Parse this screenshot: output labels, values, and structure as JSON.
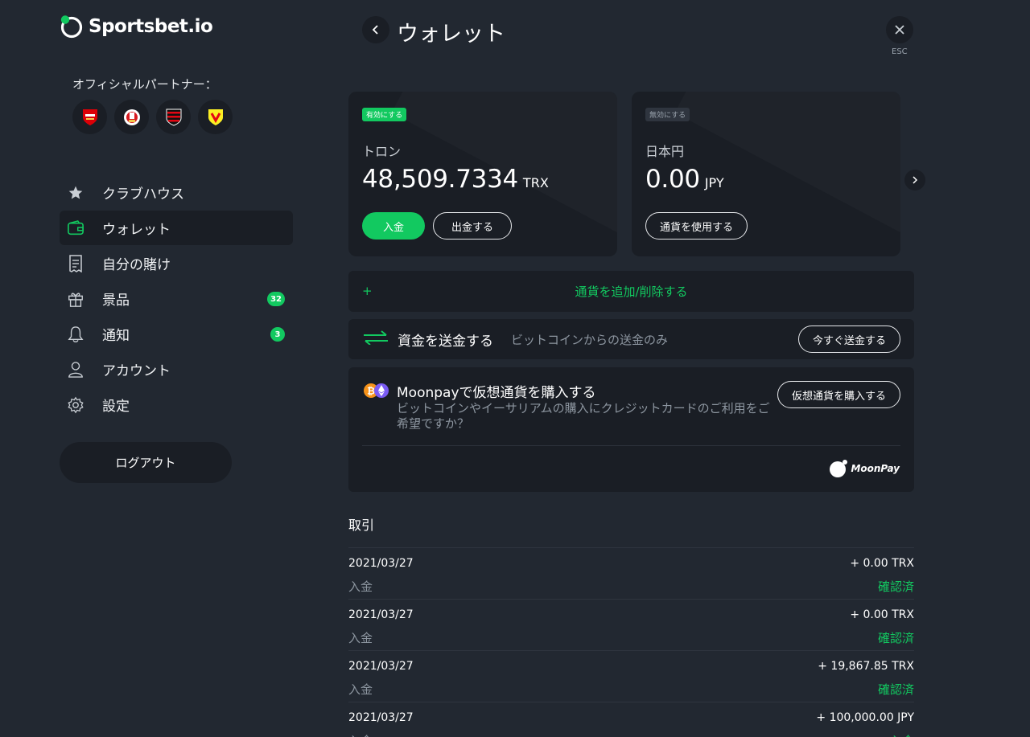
{
  "brand": {
    "name": "Sportsbet.io",
    "accent": "#12c960"
  },
  "partners": {
    "title": "オフィシャルパートナー：",
    "clubs": [
      "arsenal-crest-icon",
      "southampton-crest-icon",
      "flamengo-crest-icon",
      "watford-crest-icon"
    ]
  },
  "sidebar": {
    "items": [
      {
        "label": "クラブハウス",
        "icon": "star-icon"
      },
      {
        "label": "ウォレット",
        "icon": "wallet-icon",
        "active": true
      },
      {
        "label": "自分の賭け",
        "icon": "receipt-icon"
      },
      {
        "label": "景品",
        "icon": "gift-icon",
        "badge": "32"
      },
      {
        "label": "通知",
        "icon": "bell-icon",
        "badge": "3"
      },
      {
        "label": "アカウント",
        "icon": "user-icon"
      },
      {
        "label": "設定",
        "icon": "gear-icon"
      }
    ],
    "logout_label": "ログアウト"
  },
  "header": {
    "title": "ウォレット",
    "esc_label": "ESC"
  },
  "wallets": [
    {
      "badge": "有効にする",
      "currency": "トロン",
      "amount": "48,509.7334",
      "code": "TRX",
      "deposit_label": "入金",
      "withdraw_label": "出金する"
    },
    {
      "badge": "無効にする",
      "currency": "日本円",
      "amount": "0.00",
      "code": "JPY",
      "use_label": "通貨を使用する"
    }
  ],
  "add_currency": {
    "plus": "+",
    "label": "通貨を追加/削除する"
  },
  "send_funds": {
    "title": "資金を送金する",
    "subtitle": "ビットコインからの送金のみ",
    "button": "今すぐ送金する"
  },
  "moonpay": {
    "title": "Moonpayで仮想通貨を購入する",
    "description": "ビットコインやイーサリアムの購入にクレジットカードのご利用をご希望ですか？",
    "button": "仮想通貨を購入する",
    "logo_text": "MoonPay"
  },
  "transactions": {
    "title": "取引",
    "rows": [
      {
        "date": "2021/03/27",
        "amount": "+ 0.00 TRX",
        "type": "入金",
        "status": "確認済"
      },
      {
        "date": "2021/03/27",
        "amount": "+ 0.00 TRX",
        "type": "入金",
        "status": "確認済"
      },
      {
        "date": "2021/03/27",
        "amount": "+ 19,867.85 TRX",
        "type": "入金",
        "status": "確認済"
      },
      {
        "date": "2021/03/27",
        "amount": "+ 100,000.00 JPY",
        "type": "入金",
        "status": "入金"
      }
    ]
  }
}
